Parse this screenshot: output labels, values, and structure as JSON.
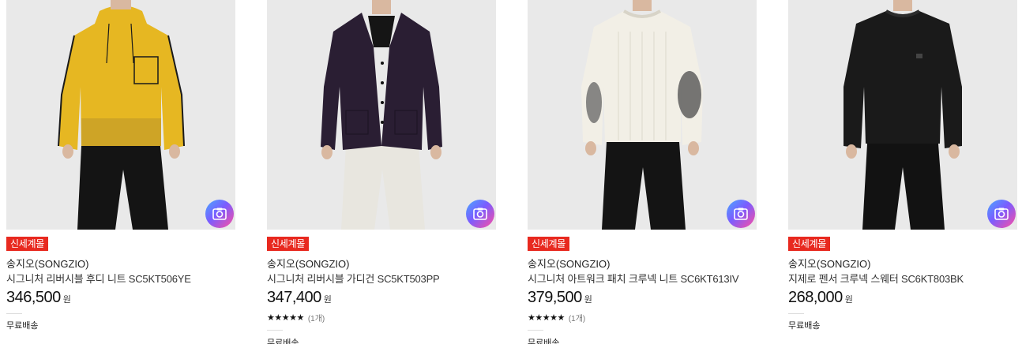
{
  "products": [
    {
      "badge": "신세계몰",
      "brand": "송지오(SONGZIO)",
      "name": "시그니처 리버시블 후디 니트 SC5KT506YE",
      "price": "346,500",
      "currency": "원",
      "rating_stars": "",
      "review_count": "",
      "shipping": "무료배송",
      "image_icon": "camera-icon",
      "garment_color": "#e6b722"
    },
    {
      "badge": "신세계몰",
      "brand": "송지오(SONGZIO)",
      "name": "시그니처 리버시블 가디건 SC5KT503PP",
      "price": "347,400",
      "currency": "원",
      "rating_stars": "★★★★★",
      "review_count": "(1개)",
      "shipping": "무료배송",
      "image_icon": "camera-icon",
      "garment_color": "#2a1e33"
    },
    {
      "badge": "신세계몰",
      "brand": "송지오(SONGZIO)",
      "name": "시그니처 아트워크 패치 크루넥 니트 SC6KT613IV",
      "price": "379,500",
      "currency": "원",
      "rating_stars": "★★★★★",
      "review_count": "(1개)",
      "shipping": "무료배송",
      "image_icon": "camera-icon",
      "garment_color": "#f2efe6"
    },
    {
      "badge": "신세계몰",
      "brand": "송지오(SONGZIO)",
      "name": "지제로 펜서 크루넥 스웨터 SC6KT803BK",
      "price": "268,000",
      "currency": "원",
      "rating_stars": "",
      "review_count": "",
      "shipping": "무료배송",
      "image_icon": "camera-icon",
      "garment_color": "#1a1a1a"
    }
  ],
  "colors": {
    "badge_bg": "#e8291f",
    "thumb_bg": "#e9e9e9"
  }
}
